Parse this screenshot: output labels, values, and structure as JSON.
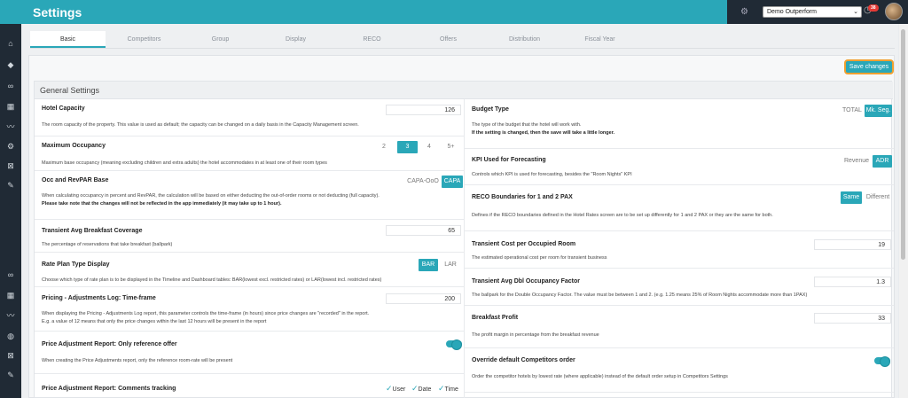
{
  "app": {
    "title": "Settings"
  },
  "topbar": {
    "hotel": "Demo Outperform",
    "notification_count": "38"
  },
  "tabs": [
    "Basic",
    "Competitors",
    "Group",
    "Display",
    "RECO",
    "Offers",
    "Distribution",
    "Fiscal Year"
  ],
  "save_label": "Save changes",
  "section_title": "General Settings",
  "left": [
    {
      "label": "Hotel Capacity",
      "value": "126",
      "desc": "The room capacity of the property. This value is used as default; the capacity can be changed on a daily basis in the Capacity Management screen."
    },
    {
      "label": "Maximum Occupancy",
      "options": [
        "2",
        "3",
        "4",
        "5+"
      ],
      "selected": "3",
      "desc": "Maximum base occupancy (meaning excluding children and extra adults) the hotel accommodates in at least one of their room types"
    },
    {
      "label": "Occ and RevPAR Base",
      "options": [
        "CAPA-OoO",
        "CAPA"
      ],
      "selected": "CAPA",
      "desc": "When calculating occupancy in percent and RevPAR, the calculation will be based on either deducting the out-of-order rooms or not deducting (full capacity).",
      "note": "Please take note that the changes will not be reflected in the app immediately (it may take up to 1 hour)."
    },
    {
      "label": "Transient Avg Breakfast Coverage",
      "value": "65",
      "desc": "The percentage of reservations that take breakfast (ballpark)"
    },
    {
      "label": "Rate Plan Type Display",
      "options": [
        "BAR",
        "LAR"
      ],
      "selected": "BAR",
      "desc": "Choose which type of rate plan is to be displayed in the Timeline and Dashboard tables: BAR(lowest excl. restricted rates) or LAR(lowest incl. restricted rates)"
    },
    {
      "label": "Pricing - Adjustments Log: Time-frame",
      "value": "200",
      "desc": "When displaying the Pricing - Adjustments Log report, this parameter controls the time-frame (in hours) since price changes are \"recorded\" in the report.",
      "desc2": "E.g. a value of 12 means that only the price changes within the last 12 hours will be present in the report"
    },
    {
      "label": "Price Adjustment Report: Only reference offer",
      "desc": "When creating the Price Adjustments report, only the reference room-rate will be present"
    },
    {
      "label": "Price Adjustment Report: Comments tracking",
      "checks": [
        "User",
        "Date",
        "Time"
      ]
    }
  ],
  "right": [
    {
      "label": "Budget Type",
      "options": [
        "TOTAL",
        "Mk. Seg."
      ],
      "selected": "Mk. Seg.",
      "desc": "The type of the budget that the hotel will work with.",
      "note": "If the setting is changed, then the save will take a little longer."
    },
    {
      "label": "KPI Used for Forecasting",
      "options": [
        "Revenue",
        "ADR"
      ],
      "selected": "ADR",
      "desc": "Controls which KPI is used for forecasting, besides the \"Room Nights\" KPI"
    },
    {
      "label": "RECO Boundaries for 1 and 2 PAX",
      "options": [
        "Same",
        "Different"
      ],
      "selected": "Same",
      "desc": "Defines if the RECO boundaries defined in the Hotel Rates screen are to be set up differently for 1 and 2 PAX or they are the same for both."
    },
    {
      "label": "Transient Cost per Occupied Room",
      "value": "19",
      "desc": "The estimated operational cost per room for transient business"
    },
    {
      "label": "Transient Avg Dbl Occupancy Factor",
      "value": "1.3",
      "desc": "The ballpark for the Double Occupancy Factor. The value must be between 1 and 2. (e.g. 1.25 means 25% of Room Nights accommodate more than 1PAX)"
    },
    {
      "label": "Breakfast Profit",
      "value": "33",
      "desc": "The profit margin in percentage from the breakfast revenue"
    },
    {
      "label": "Override default Competitors order",
      "desc": "Order the competitor hotels by lowest rate (where applicable) instead of the default order setup in Competitors Settings"
    }
  ]
}
